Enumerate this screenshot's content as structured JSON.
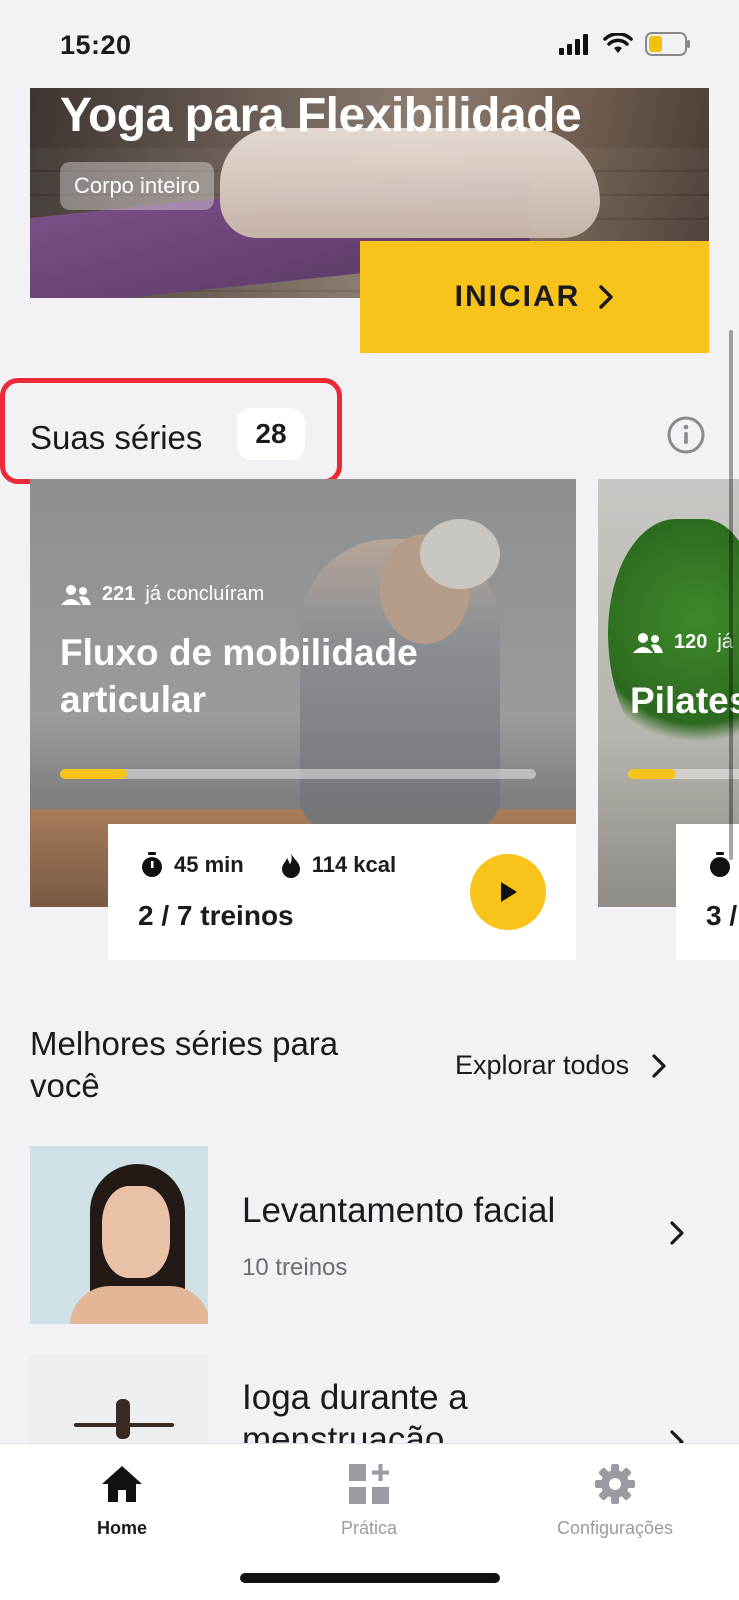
{
  "status_bar": {
    "time": "15:20"
  },
  "hero": {
    "title": "Yoga para Flexibilidade",
    "tag": "Corpo inteiro",
    "start_label": "INICIAR"
  },
  "your_series": {
    "label": "Suas séries",
    "count": "28",
    "cards": [
      {
        "completed_count": "221",
        "completed_suffix": "já concluíram",
        "title_line1": "Fluxo de mobilidade",
        "title_line2": "articular",
        "progress": 0.14,
        "duration": "45 min",
        "calories": "114 kcal",
        "workouts": "2 / 7 treinos"
      },
      {
        "completed_count": "120",
        "completed_suffix": "já",
        "title_line1": "Pilates",
        "progress": 0.3,
        "workouts": "3 /"
      }
    ]
  },
  "best_series": {
    "title": "Melhores séries para você",
    "explore_label": "Explorar todos",
    "items": [
      {
        "name": "Levantamento facial",
        "workouts": "10 treinos"
      },
      {
        "name": "Ioga durante a menstruação"
      }
    ]
  },
  "tabbar": {
    "tabs": [
      {
        "label": "Home",
        "icon": "home-icon",
        "active": true
      },
      {
        "label": "Prática",
        "icon": "practice-icon",
        "active": false
      },
      {
        "label": "Configurações",
        "icon": "gear-icon",
        "active": false
      }
    ]
  },
  "colors": {
    "accent": "#f8c41b",
    "highlight": "#ea2a35",
    "background": "#f1f1f6"
  }
}
